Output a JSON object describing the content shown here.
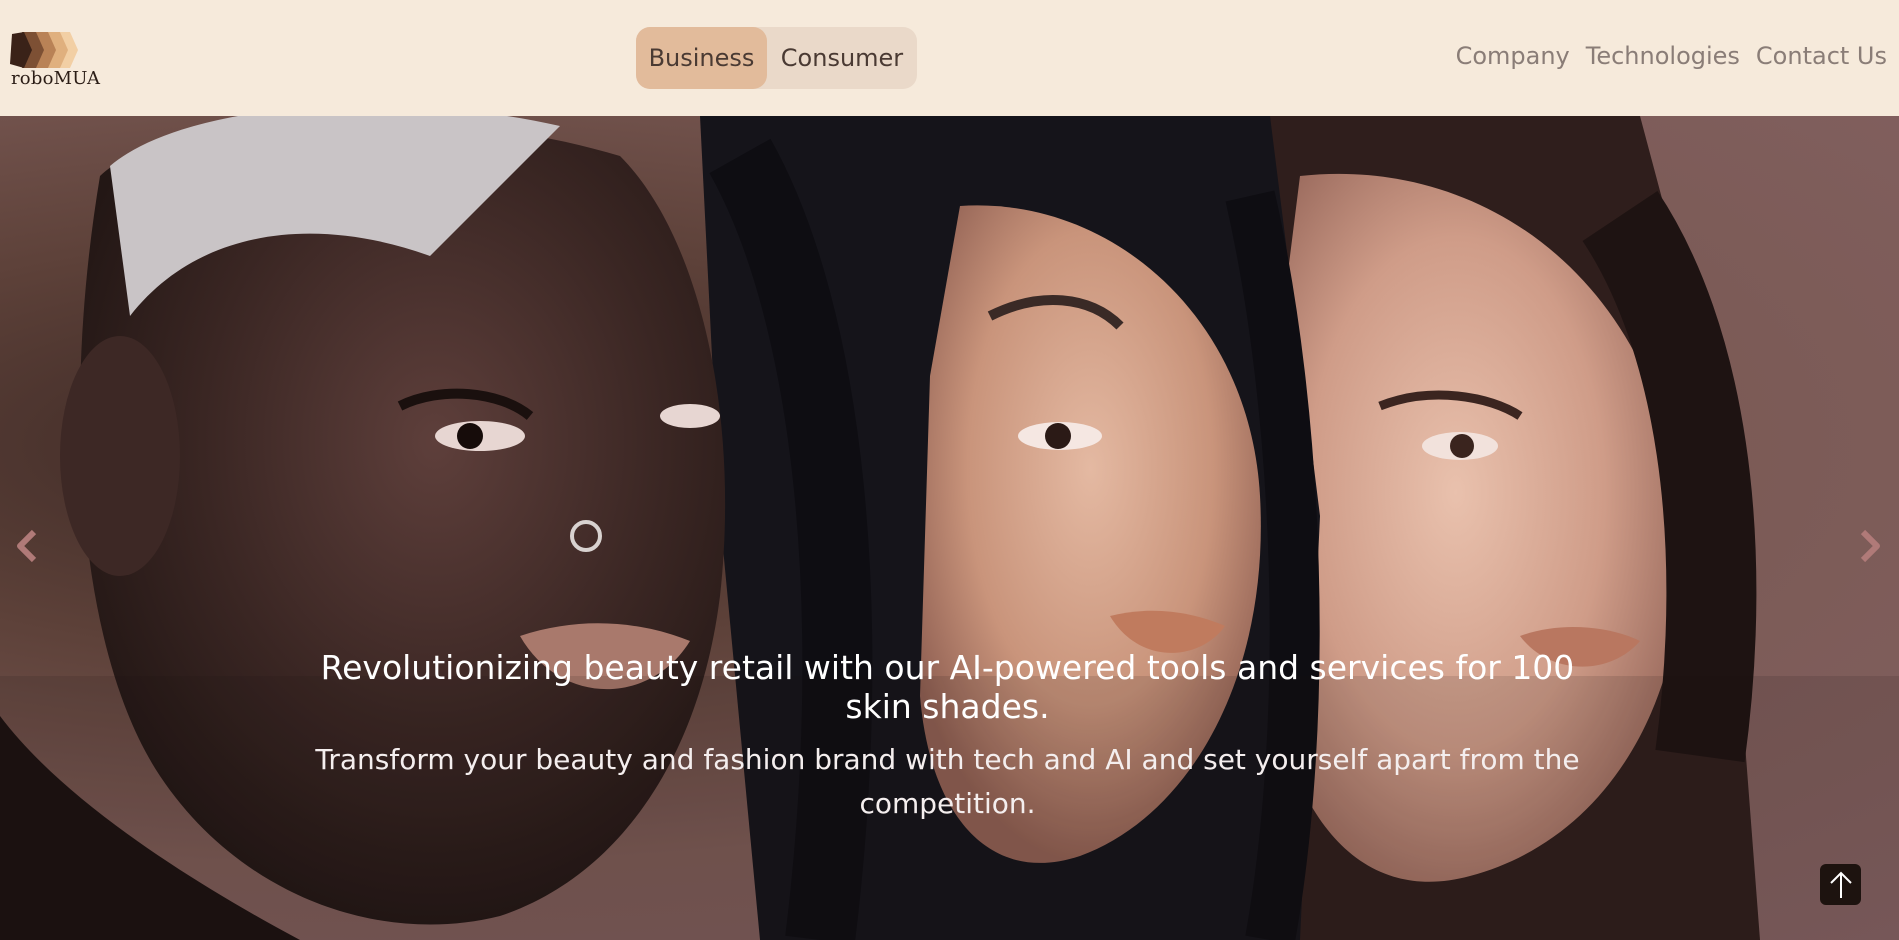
{
  "brand": {
    "logo_text": "roboMUA"
  },
  "segment": {
    "items": [
      {
        "label": "Business",
        "active": true
      },
      {
        "label": "Consumer",
        "active": false
      }
    ]
  },
  "nav": {
    "links": [
      "Company",
      "Technologies",
      "Contact Us"
    ]
  },
  "hero": {
    "title": "Revolutionizing beauty retail with our AI-powered tools and services for 100 skin shades.",
    "subtitle": "Transform your beauty and fashion brand with tech and AI and set yourself apart from the competition.",
    "image_alt": "Three models with different skin tones"
  },
  "colors": {
    "header_bg": "#f6eadb",
    "segment_active": "#e2bb9b",
    "segment_bg": "#ead9c9",
    "nav_text": "#8a7d77",
    "arrow": "#b07a78"
  },
  "icons": {
    "prev": "chevron-left-icon",
    "next": "chevron-right-icon",
    "scroll_top": "arrow-up-icon"
  }
}
